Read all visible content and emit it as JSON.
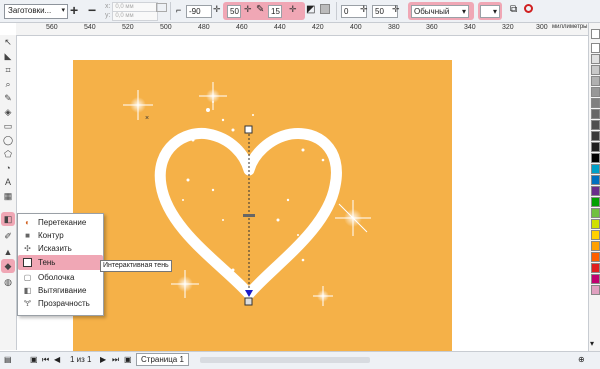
{
  "toolbar": {
    "preset": "Заготовки...",
    "x_label": "x:",
    "y_label": "y:",
    "x_value": "0,0 мм",
    "y_value": "0,0 мм",
    "angle": "-90",
    "opacity": "50",
    "feather": "15",
    "offset": "0",
    "fade": "50",
    "merge_mode": "Обычный"
  },
  "ruler": {
    "unit": "миллиметры",
    "ticks": [
      "560",
      "540",
      "520",
      "500",
      "480",
      "460",
      "440",
      "420",
      "400",
      "380",
      "360",
      "340",
      "320",
      "300"
    ]
  },
  "flyout": {
    "items": [
      {
        "label": "Перетекание",
        "icon": "blend-icon"
      },
      {
        "label": "Контур",
        "icon": "contour-icon"
      },
      {
        "label": "Исказить",
        "icon": "distort-icon"
      },
      {
        "label": "Тень",
        "icon": "shadow-icon"
      },
      {
        "label": "Оболочка",
        "icon": "envelope-icon"
      },
      {
        "label": "Вытягивание",
        "icon": "extrude-icon"
      },
      {
        "label": "Прозрачность",
        "icon": "transparency-icon"
      }
    ]
  },
  "tooltip": "Интерактивная тень",
  "status": {
    "page_counter": "1 из 1",
    "page_tab": "Страница 1"
  },
  "colors": {
    "page": "#f5b148",
    "highlight": "#f0a7b5",
    "heart": "#ffffff",
    "shadow_handle": "#1a1ac8"
  },
  "palette": [
    "#ffffff",
    "#e0e0e0",
    "#c8c8c8",
    "#b0b0b0",
    "#989898",
    "#808080",
    "#686868",
    "#505050",
    "#383838",
    "#202020",
    "#000000",
    "#00a0c8",
    "#0070c0",
    "#6a2c8c",
    "#00a000",
    "#70c040",
    "#d0e000",
    "#ffd000",
    "#ffa000",
    "#ff6000",
    "#e02020",
    "#c00070",
    "#e0a0c0"
  ]
}
